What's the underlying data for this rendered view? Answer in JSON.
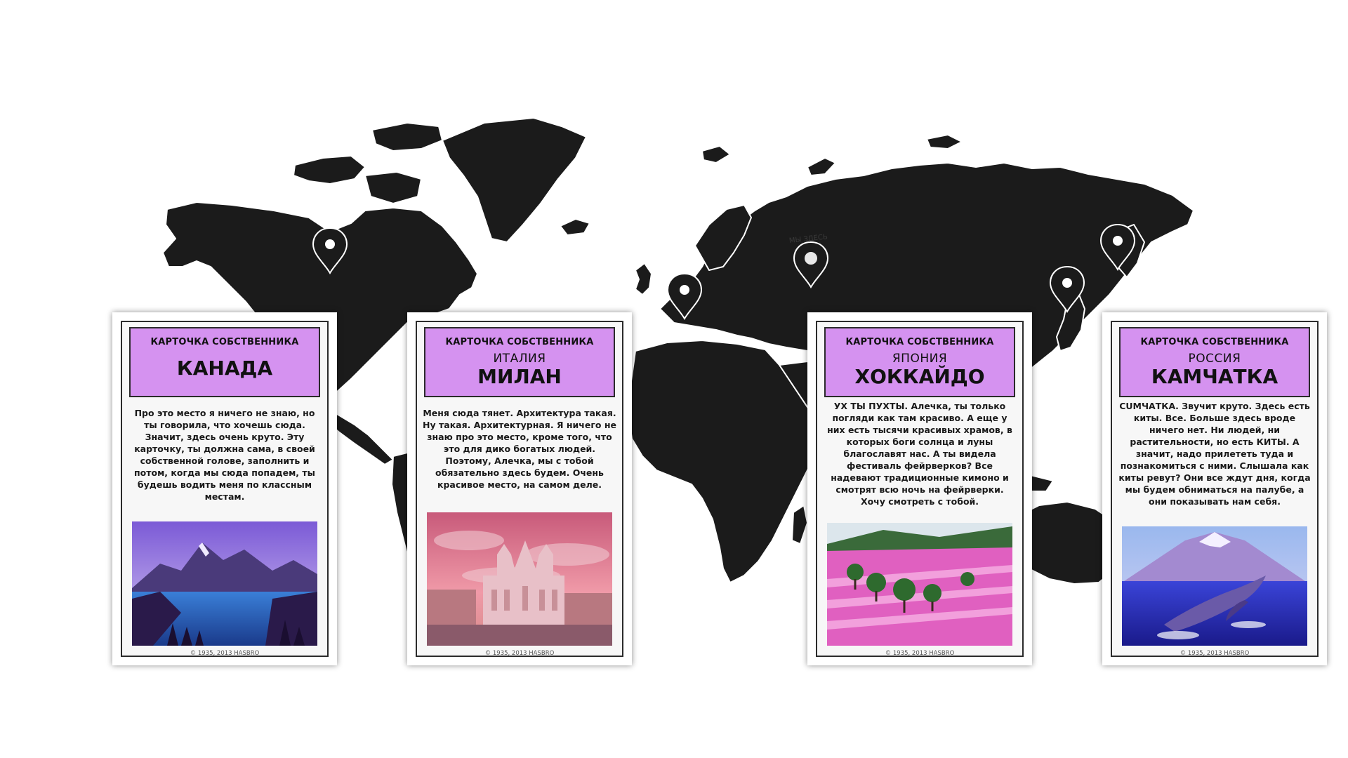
{
  "map": {
    "here_label": "МЫ ЗДЕСЬ"
  },
  "cards": [
    {
      "label": "КАРТОЧКА СОБСТВЕННИКА",
      "region": "",
      "title": "КАНАДА",
      "text": "Про это место я ничего не знаю, но ты говорила, что хочешь сюда. Значит, здесь очень круто. Эту карточку, ты должна сама, в своей собственной голове, заполнить и потом, когда мы сюда попадем, ты будешь водить меня по классным местам.",
      "footer": "© 1935, 2013 HASBRO"
    },
    {
      "label": "КАРТОЧКА СОБСТВЕННИКА",
      "region": "ИТАЛИЯ",
      "title": "МИЛАН",
      "text": "Меня сюда тянет. Архитектура такая. Ну такая. Архитектурная. Я ничего не знаю про это место, кроме того, что это для дико богатых людей. Поэтому, Алечка, мы с тобой обязательно здесь будем. Очень красивое место, на самом деле.",
      "footer": "© 1935, 2013 HASBRO"
    },
    {
      "label": "КАРТОЧКА СОБСТВЕННИКА",
      "region": "ЯПОНИЯ",
      "title": "ХОККАЙДО",
      "text": "УХ ТЫ ПУХТЫ. Алечка, ты только погляди как там красиво. А еще у них есть тысячи красивых храмов, в которых боги солнца и луны благославят нас. А ты видела фестиваль фейрверков? Все надевают традиционные кимоно и смотрят всю ночь на фейрверки. Хочу смотреть с тобой.",
      "footer": "© 1935, 2013 HASBRO"
    },
    {
      "label": "КАРТОЧКА СОБСТВЕННИКА",
      "region": "РОССИЯ",
      "title": "КАМЧАТКА",
      "text": "СUМЧАТКА. Звучит круто. Здесь есть киты. Все. Больше здесь вроде ничего нет. Ни людей, ни растительности, но есть КИТЫ. А значит, надо прилететь туда и познакомиться с ними. Слышала как киты ревут? Они все ждут дня, когда мы будем обниматься на палубе, а они показывать нам себя.",
      "footer": "© 1935, 2013 HASBRO"
    }
  ],
  "colors": {
    "header_purple": "#d592f0",
    "map_land": "#1b1b1b"
  }
}
